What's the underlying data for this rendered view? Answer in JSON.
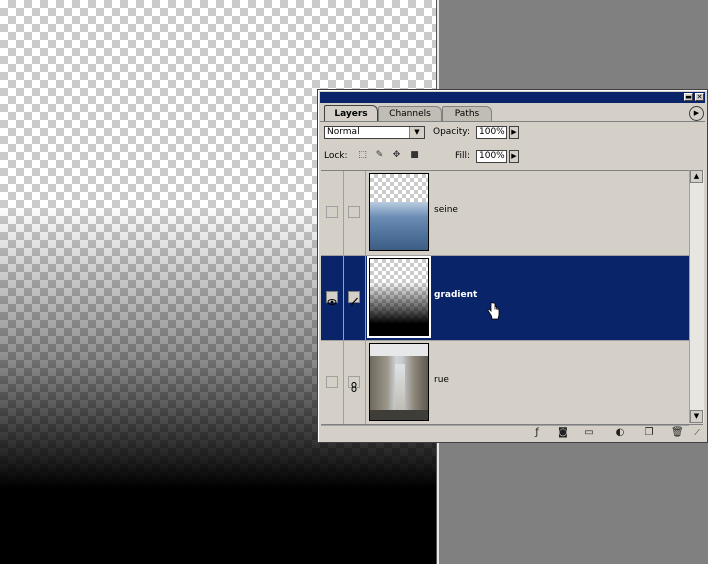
{
  "canvas": {
    "background": "checkerboard",
    "overlay": "transparent-to-black gradient"
  },
  "palette": {
    "tabs": [
      {
        "label": "Layers",
        "active": true
      },
      {
        "label": "Channels",
        "active": false
      },
      {
        "label": "Paths",
        "active": false
      }
    ],
    "blend_mode": "Normal",
    "opacity_label": "Opacity:",
    "opacity_value": "100%",
    "lock_label": "Lock:",
    "fill_label": "Fill:",
    "fill_value": "100%",
    "title_buttons": {
      "minimize": "▬",
      "close": "✕"
    }
  },
  "layers": [
    {
      "name": "seine",
      "visible": false,
      "selected": false
    },
    {
      "name": "gradient",
      "visible": true,
      "selected": true
    },
    {
      "name": "rue",
      "visible": false,
      "selected": false,
      "linked": true
    }
  ],
  "colors": {
    "selection": "#0a246a",
    "panel": "#d4d0c8",
    "desktop": "#808080"
  }
}
